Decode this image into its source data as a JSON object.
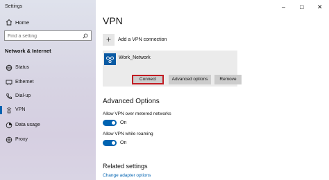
{
  "window": {
    "title": "Settings",
    "controls": {
      "minimize": "–",
      "maximize": "□",
      "close": "✕"
    }
  },
  "sidebar": {
    "home": {
      "label": "Home",
      "icon": "home-icon"
    },
    "search": {
      "placeholder": "Find a setting",
      "icon": "search-icon"
    },
    "section_title": "Network & Internet",
    "items": [
      {
        "label": "Status",
        "icon": "status-icon",
        "active": false
      },
      {
        "label": "Ethernet",
        "icon": "ethernet-icon",
        "active": false
      },
      {
        "label": "Dial-up",
        "icon": "dial-up-icon",
        "active": false
      },
      {
        "label": "VPN",
        "icon": "vpn-icon",
        "active": true
      },
      {
        "label": "Data usage",
        "icon": "data-usage-icon",
        "active": false
      },
      {
        "label": "Proxy",
        "icon": "proxy-icon",
        "active": false
      }
    ]
  },
  "main": {
    "title": "VPN",
    "add_connection": {
      "icon_glyph": "+",
      "label": "Add a VPN connection"
    },
    "connection": {
      "name": "Work_Network",
      "buttons": {
        "connect": "Connect",
        "advanced": "Advanced options",
        "remove": "Remove"
      }
    },
    "advanced": {
      "heading": "Advanced Options",
      "options": [
        {
          "label": "Allow VPN over metered networks",
          "state": "On"
        },
        {
          "label": "Allow VPN while roaming",
          "state": "On"
        }
      ]
    },
    "related": {
      "heading": "Related settings",
      "link": "Change adapter options"
    }
  },
  "colors": {
    "accent": "#0063b1",
    "highlight_border": "#c11b22",
    "vpn_icon_bg": "#0a5aa3",
    "button_bg": "#cccccc",
    "card_bg": "#ebebeb"
  }
}
